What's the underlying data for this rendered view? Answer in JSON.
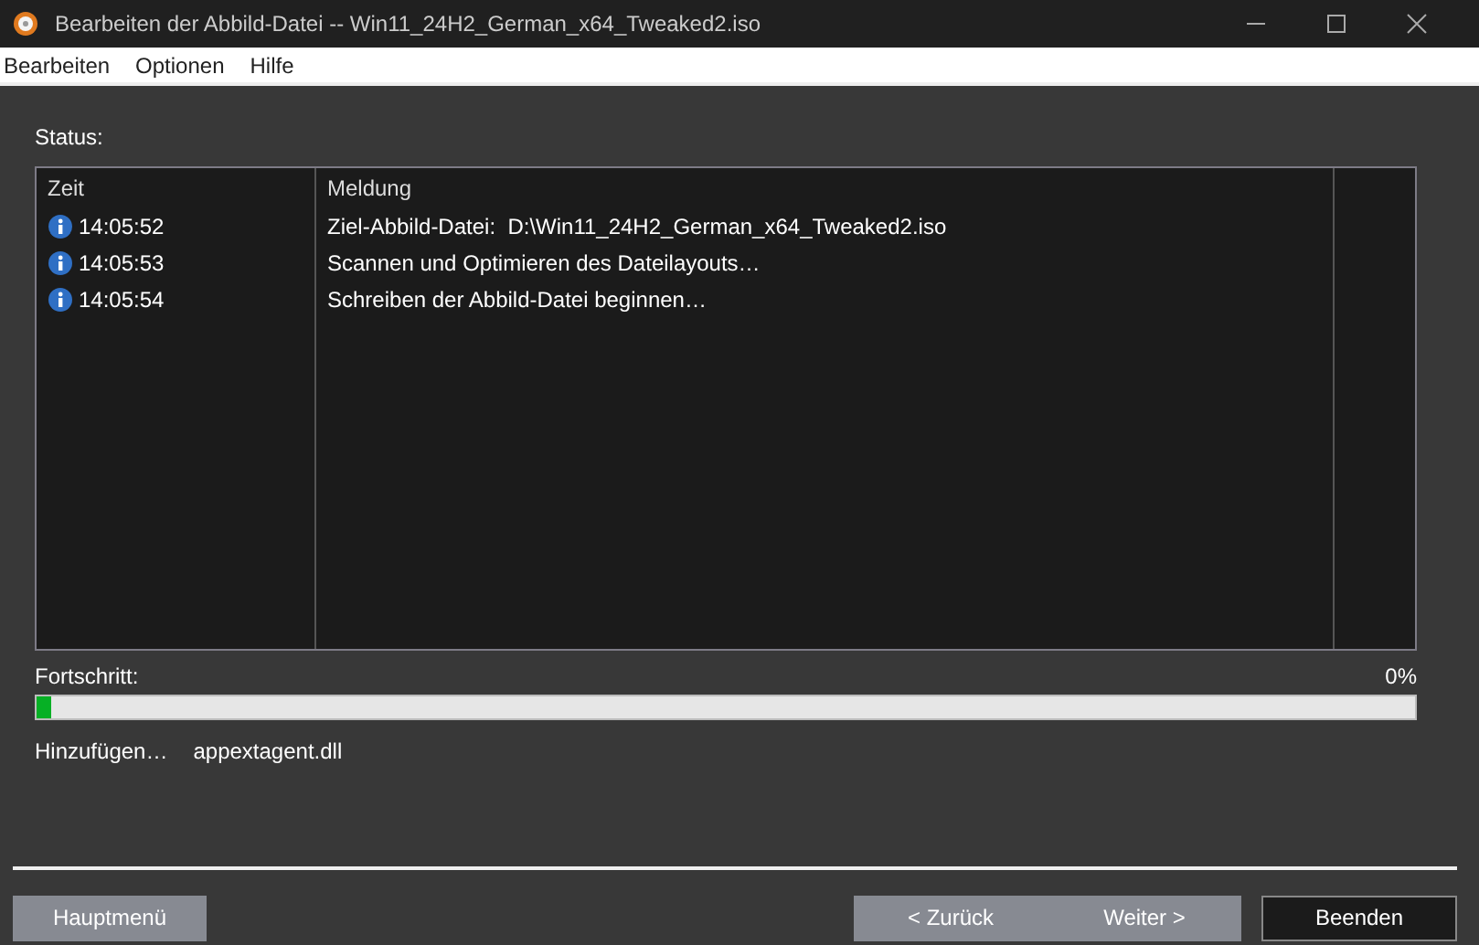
{
  "window": {
    "title": "Bearbeiten der Abbild-Datei -- Win11_24H2_German_x64_Tweaked2.iso"
  },
  "menu": [
    "Bearbeiten",
    "Optionen",
    "Hilfe"
  ],
  "status": {
    "label": "Status:"
  },
  "log": {
    "columns": [
      "Zeit",
      "Meldung"
    ],
    "rows": [
      {
        "time": "14:05:52",
        "message": "Ziel-Abbild-Datei:  D:\\Win11_24H2_German_x64_Tweaked2.iso"
      },
      {
        "time": "14:05:53",
        "message": "Scannen und Optimieren des Dateilayouts…"
      },
      {
        "time": "14:05:54",
        "message": "Schreiben der Abbild-Datei beginnen…"
      }
    ]
  },
  "progress": {
    "label": "Fortschritt:",
    "reading": "0%",
    "level": 0.01
  },
  "current": {
    "action": "Hinzufügen…",
    "file": "appextagent.dll"
  },
  "footer": {
    "left": [
      {
        "label": "Hauptmenü",
        "default": false
      }
    ],
    "nav": [
      {
        "label": "< Zurück",
        "default": false
      },
      {
        "label": "Weiter >",
        "default": false
      }
    ],
    "right": [
      {
        "label": "Beenden",
        "default": true
      }
    ]
  }
}
